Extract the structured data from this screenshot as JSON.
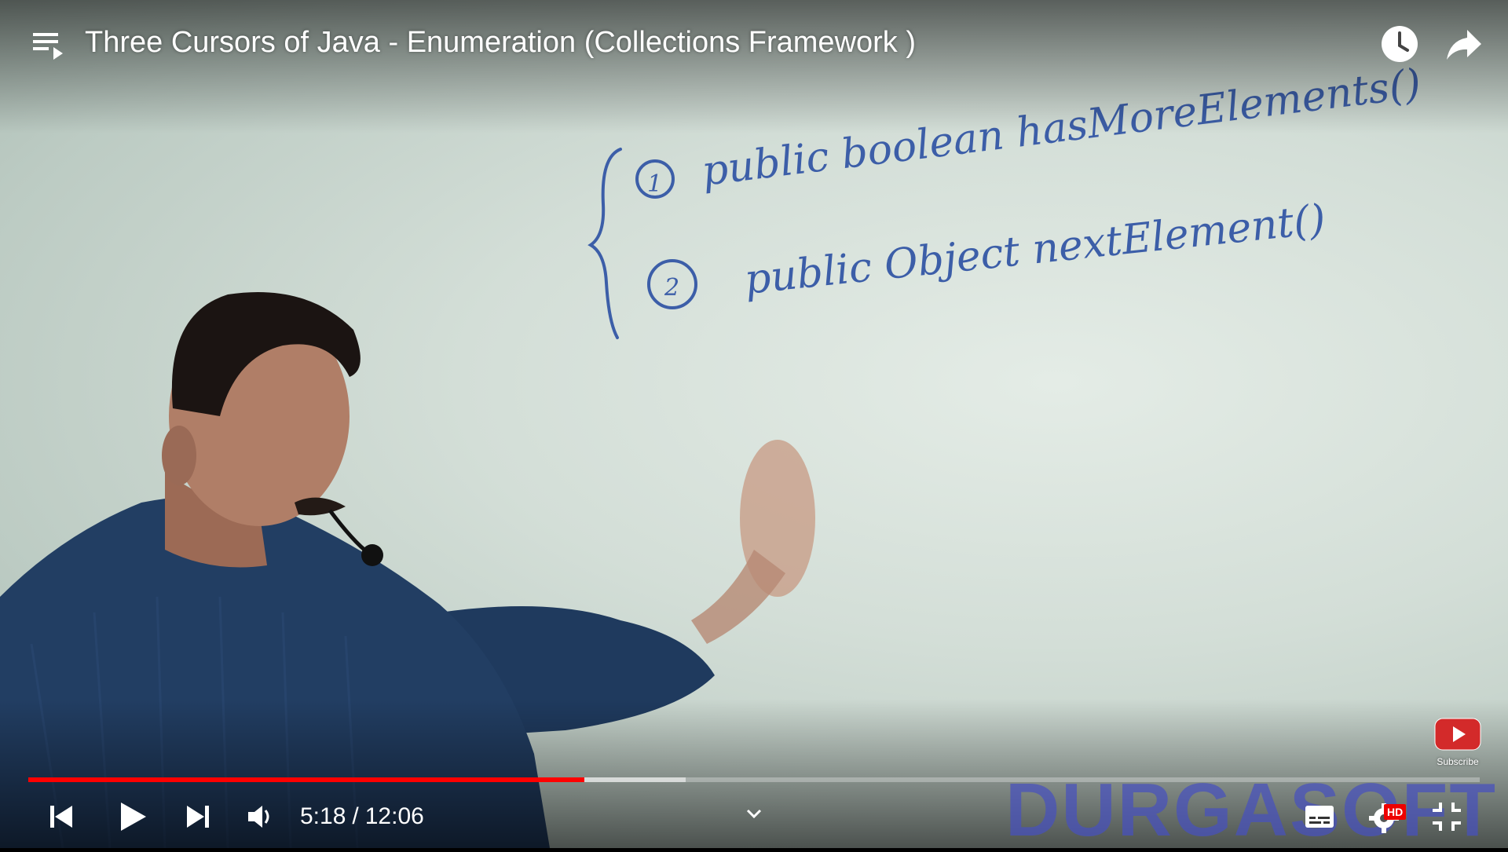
{
  "player": {
    "title": "Three Cursors of Java - Enumeration (Collections Framework )",
    "time": {
      "current": "5:18",
      "separator": "/",
      "duration": "12:06"
    },
    "progress": {
      "played_fraction": 0.383,
      "buffered_fraction": 0.453
    },
    "subscribe_label": "Subscribe",
    "watermark": "DURGASOFT",
    "hd_badge": "HD",
    "accent_color": "#ff0000"
  },
  "whiteboard": {
    "bracket": "{",
    "line1": {
      "number": "1",
      "text": "public boolean hasMoreElements()"
    },
    "line2": {
      "number": "2",
      "text": "public Object nextElement()"
    }
  },
  "icons": {
    "playlist": "playlist-icon",
    "watch_later": "clock-icon",
    "share": "share-icon",
    "previous": "skip-previous-icon",
    "play": "play-icon",
    "next": "skip-next-icon",
    "volume": "volume-icon",
    "expand": "chevron-down-icon",
    "captions": "captions-icon",
    "settings": "gear-icon",
    "exit_fullscreen": "exit-fullscreen-icon",
    "subscribe": "youtube-logo-icon"
  }
}
